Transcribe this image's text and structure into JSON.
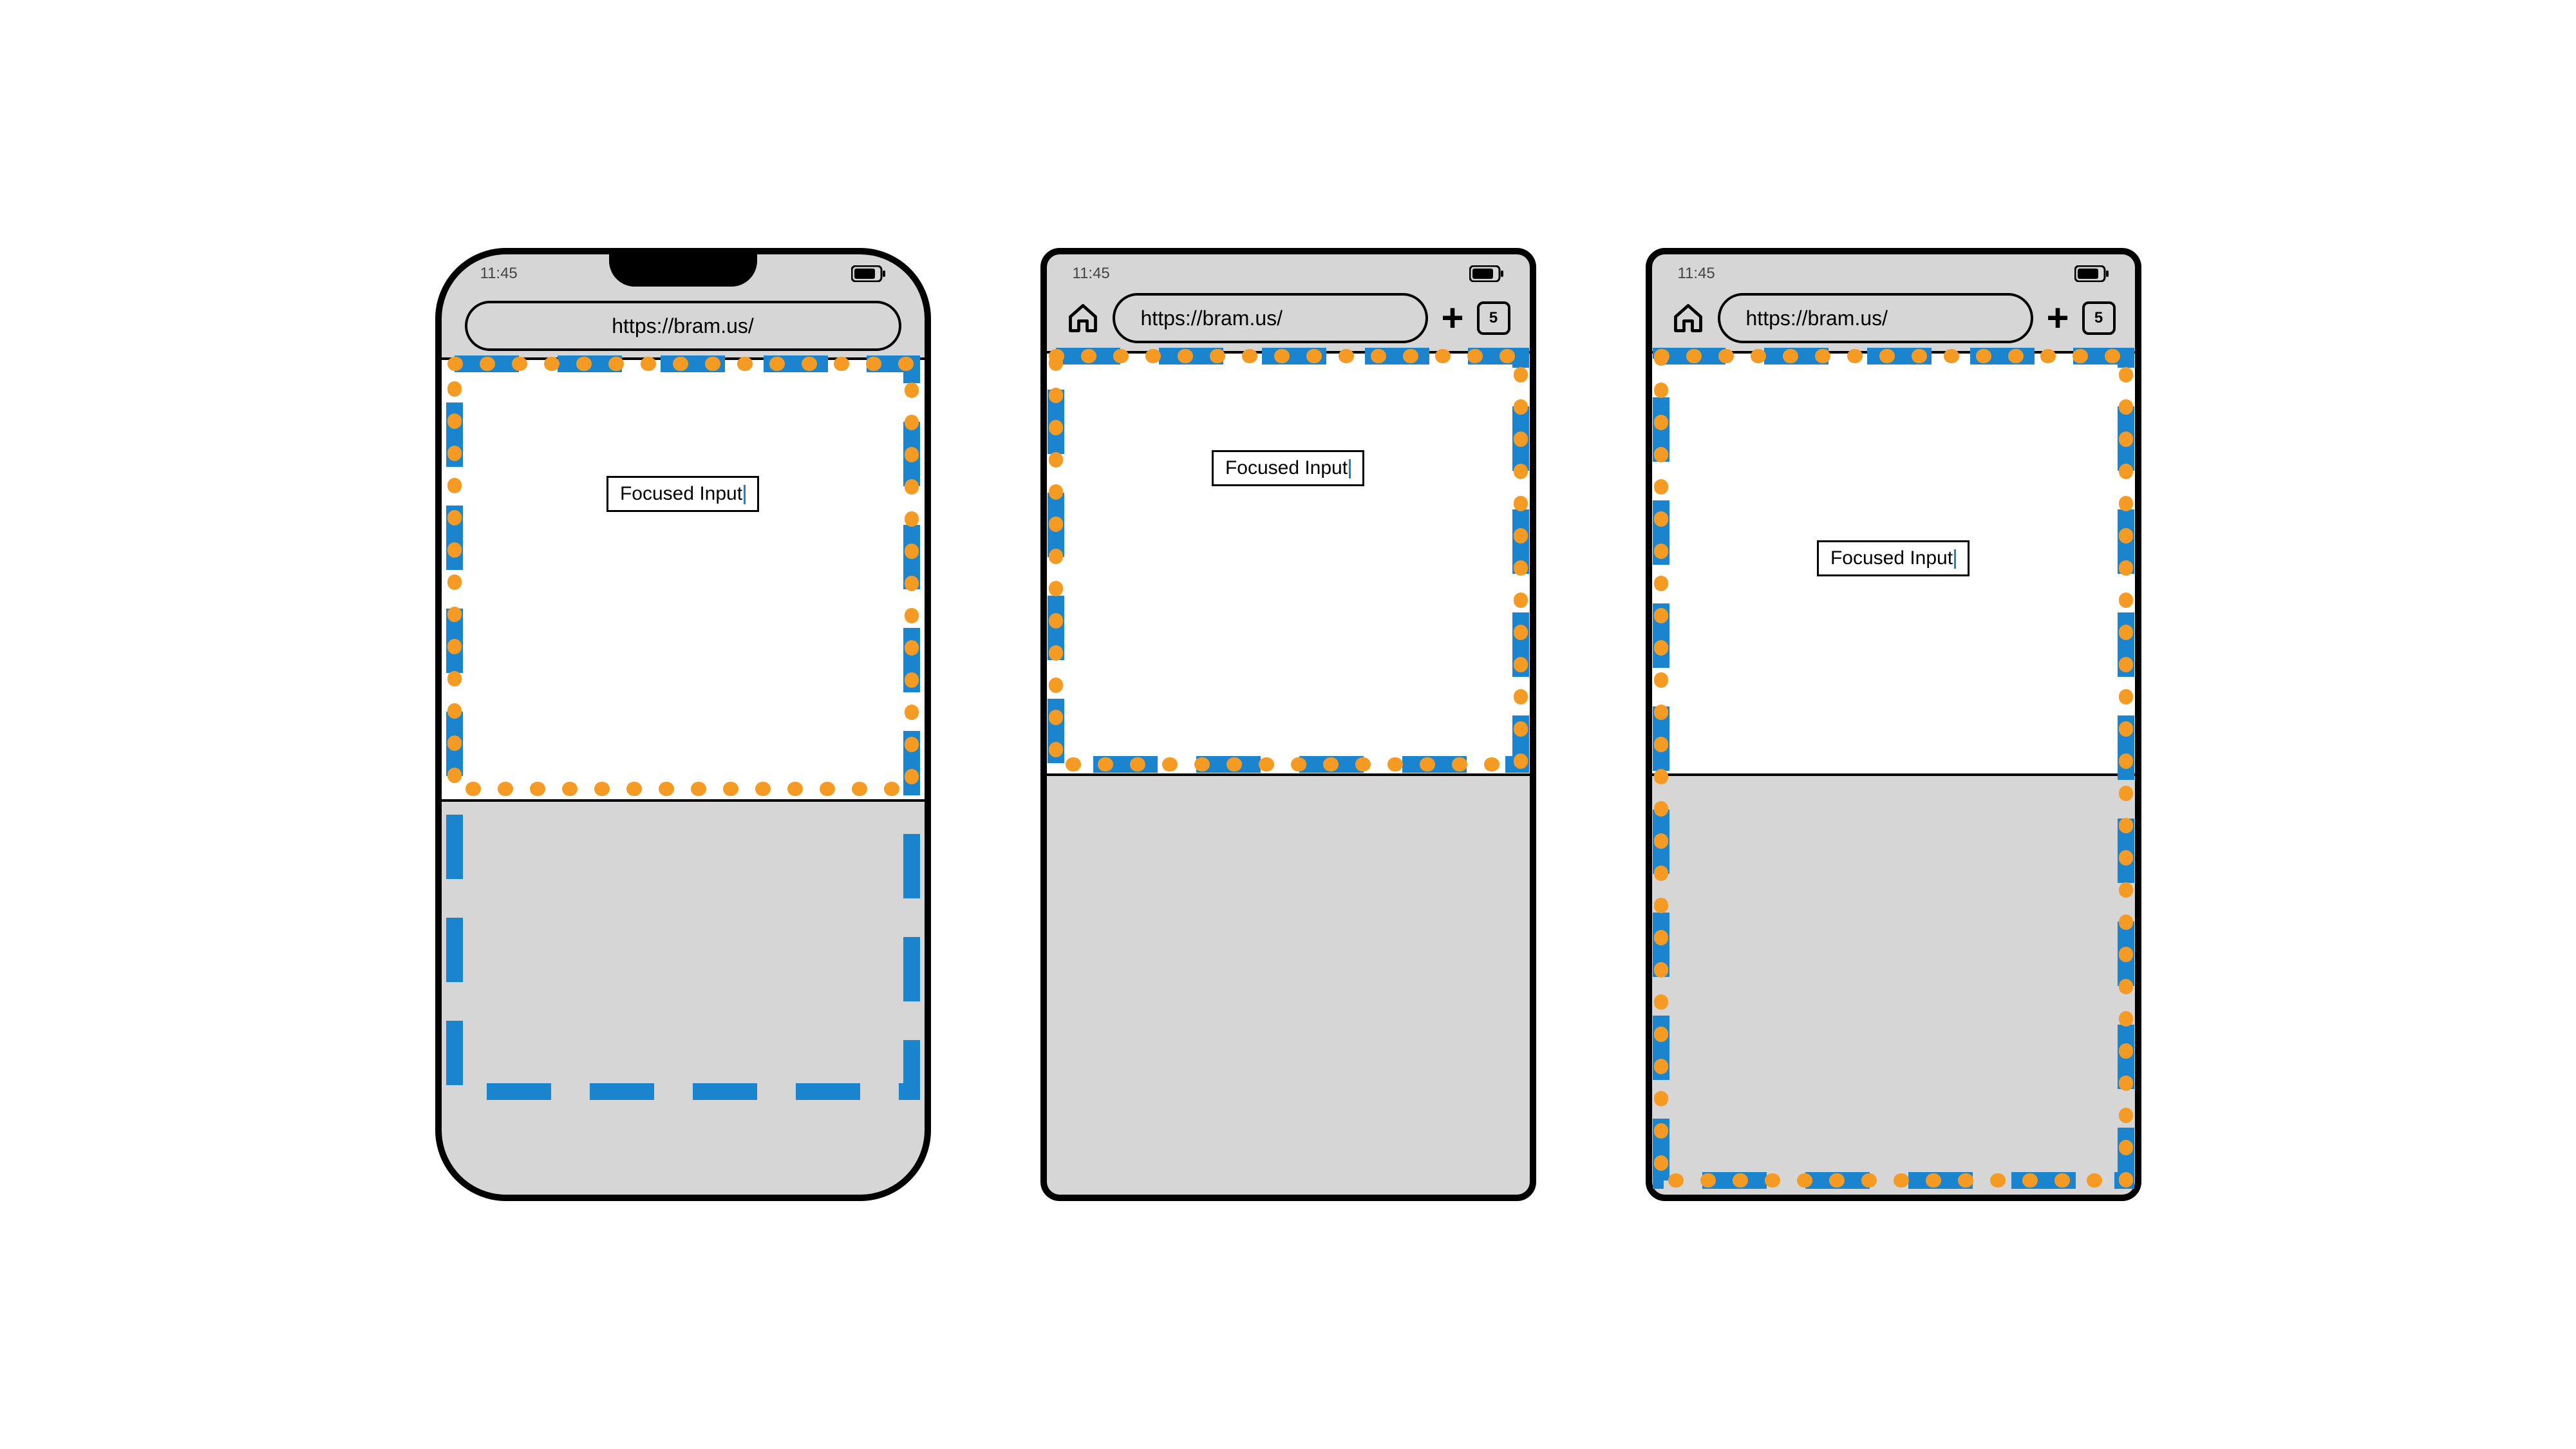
{
  "status": {
    "time": "11:45"
  },
  "browser": {
    "url": "https://bram.us/",
    "tab_count": "5"
  },
  "input": {
    "value": "Focused Input"
  },
  "colors": {
    "dash_blue": "#1a84cf",
    "dot_orange": "#f59b23",
    "chrome_grey": "#d6d6d6"
  }
}
